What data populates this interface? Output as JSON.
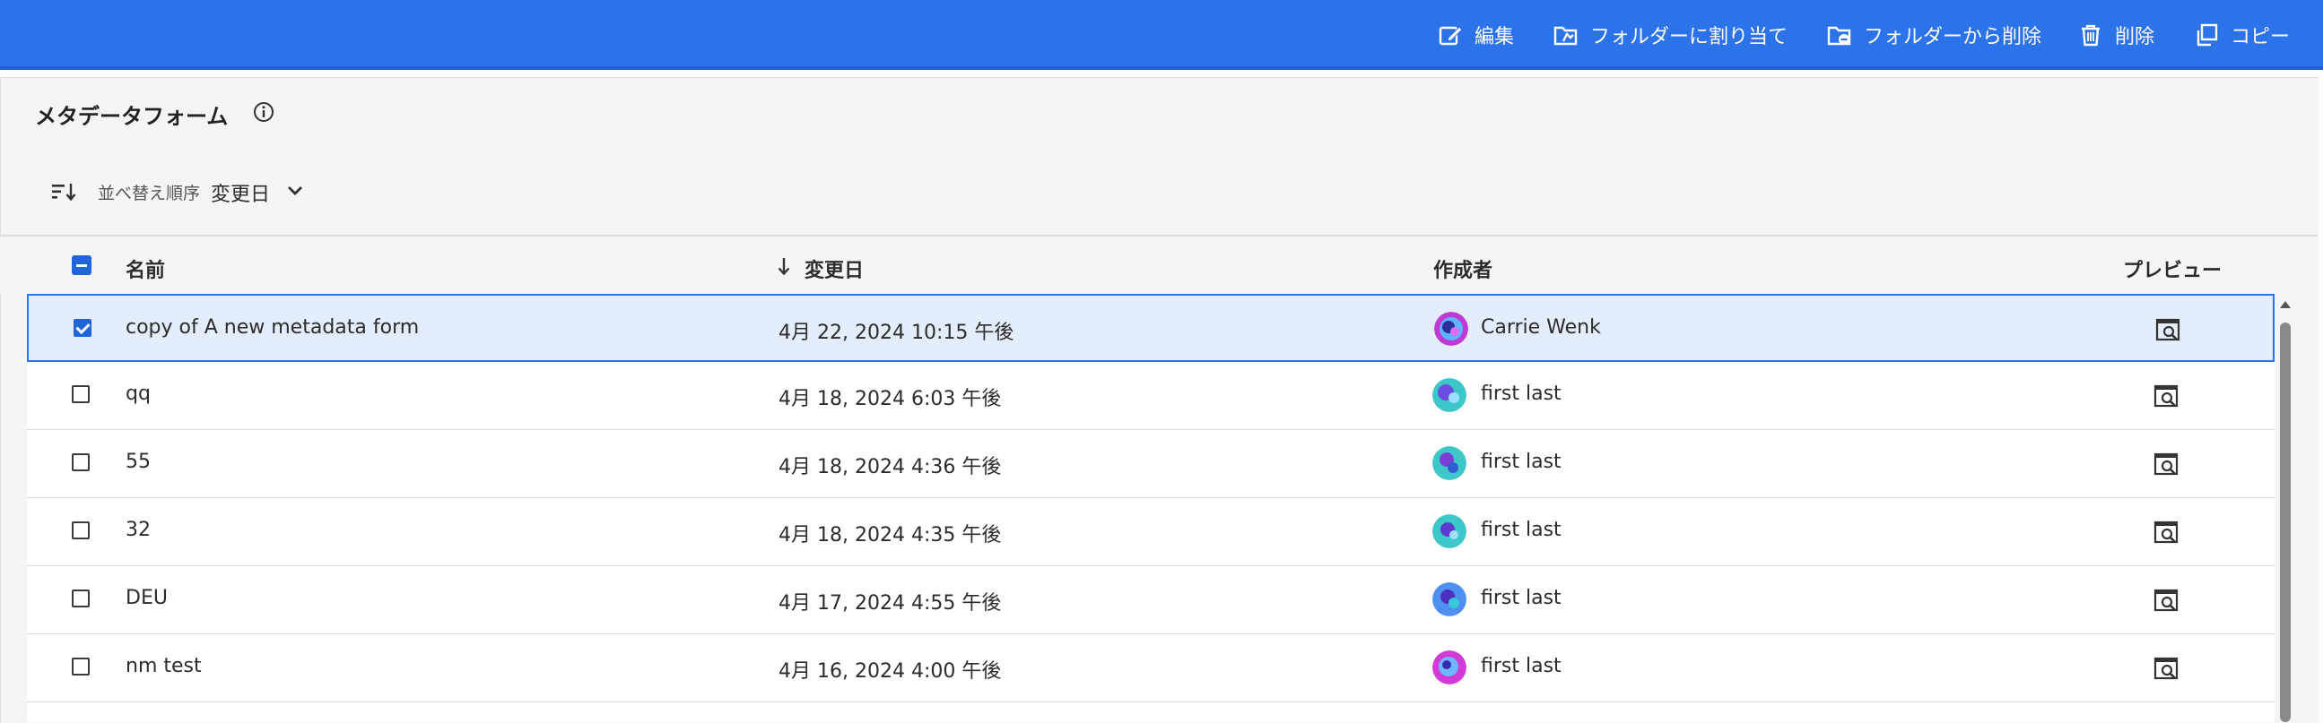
{
  "toolbar": {
    "actions": [
      {
        "label": "編集",
        "icon": "edit-icon"
      },
      {
        "label": "フォルダーに割り当て",
        "icon": "folder-assign-icon"
      },
      {
        "label": "フォルダーから削除",
        "icon": "folder-remove-icon"
      },
      {
        "label": "削除",
        "icon": "trash-icon"
      },
      {
        "label": "コピー",
        "icon": "copy-icon"
      }
    ]
  },
  "panel": {
    "title": "メタデータフォーム",
    "sort": {
      "label": "並べ替え順序",
      "value": "変更日"
    }
  },
  "table": {
    "columns": [
      "名前",
      "変更日",
      "作成者",
      "プレビュー"
    ],
    "sorted_column": "変更日",
    "sort_direction": "descending",
    "rows": [
      {
        "name": "copy of A new metadata form",
        "modified": "4月 22, 2024 10:15 午後",
        "author": "Carrie Wenk",
        "selected": true
      },
      {
        "name": "qq",
        "modified": "4月 18, 2024 6:03 午後",
        "author": "first last",
        "selected": false
      },
      {
        "name": "55",
        "modified": "4月 18, 2024 4:36 午後",
        "author": "first last",
        "selected": false
      },
      {
        "name": "32",
        "modified": "4月 18, 2024 4:35 午後",
        "author": "first last",
        "selected": false
      },
      {
        "name": "DEU",
        "modified": "4月 17, 2024 4:55 午後",
        "author": "first last",
        "selected": false
      },
      {
        "name": "nm test",
        "modified": "4月 16, 2024 4:00 午後",
        "author": "first last",
        "selected": false
      }
    ]
  },
  "colors": {
    "accent": "#2c72e8",
    "selected_row": "#e4eefb",
    "checkbox": "#1f65d9"
  }
}
